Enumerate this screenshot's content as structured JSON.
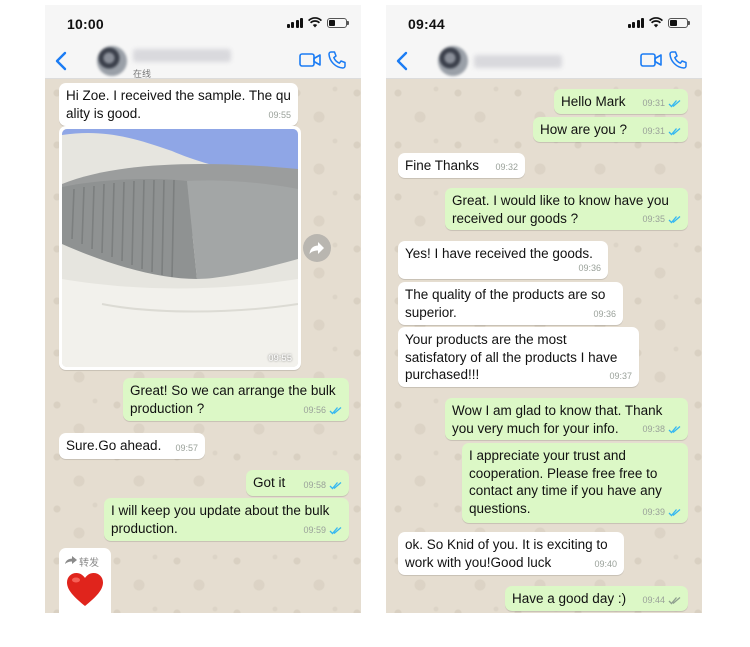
{
  "left": {
    "time": "10:00",
    "contact_status": "在线",
    "photo_time": "09:55",
    "forward_label": "转发",
    "messages": [
      {
        "dir": "in",
        "text": "Hi Zoe. I received the sample. The qu\nality is good.",
        "time": "09:55"
      },
      {
        "dir": "out",
        "text": "Great! So we can arrange the bulk\nproduction ?",
        "time": "09:56"
      },
      {
        "dir": "in",
        "text": "Sure.Go ahead.",
        "time": "09:57"
      },
      {
        "dir": "out",
        "text": "Got it",
        "time": "09:58"
      },
      {
        "dir": "out",
        "text": "I will keep you update about the bulk\nproduction.",
        "time": "09:59"
      }
    ]
  },
  "right": {
    "time": "09:44",
    "messages": [
      {
        "dir": "out",
        "text": "Hello Mark",
        "time": "09:31"
      },
      {
        "dir": "out",
        "text": "How are you ?",
        "time": "09:31"
      },
      {
        "dir": "in",
        "text": "Fine Thanks",
        "time": "09:32"
      },
      {
        "dir": "out",
        "text": "Great. I would like to know have you\nreceived our goods ?",
        "time": "09:35"
      },
      {
        "dir": "in",
        "text": "Yes! I have received the goods.",
        "time": "09:36"
      },
      {
        "dir": "in",
        "text": "The quality of the products are so\nsuperior.",
        "time": "09:36"
      },
      {
        "dir": "in",
        "text": "Your products are the most\nsatisfatory of all the products I have\npurchased!!!",
        "time": "09:37"
      },
      {
        "dir": "out",
        "text": "Wow I am glad to know that. Thank\nyou very much for your info.",
        "time": "09:38"
      },
      {
        "dir": "out",
        "text": "I appreciate your trust and\ncooperation. Please free free to\ncontact any time if you have any\nquestions.",
        "time": "09:39"
      },
      {
        "dir": "in",
        "text": "ok. So Knid of you. It is exciting to\nwork with you!Good luck",
        "time": "09:40"
      },
      {
        "dir": "out",
        "text": "Have a good day :)",
        "time": "09:44"
      }
    ]
  },
  "colors": {
    "incoming_bubble": "#ffffff",
    "outgoing_bubble": "#dcf8c6",
    "read_ticks": "#34b7f1",
    "ios_blue": "#1b7cf4",
    "chat_background": "#e5ddd0"
  },
  "icons": [
    "back-chevron-icon",
    "video-call-icon",
    "phone-call-icon",
    "read-ticks-icon",
    "forward-icon",
    "red-heart-emoji-icon",
    "signal-icon",
    "wifi-icon",
    "battery-icon"
  ]
}
